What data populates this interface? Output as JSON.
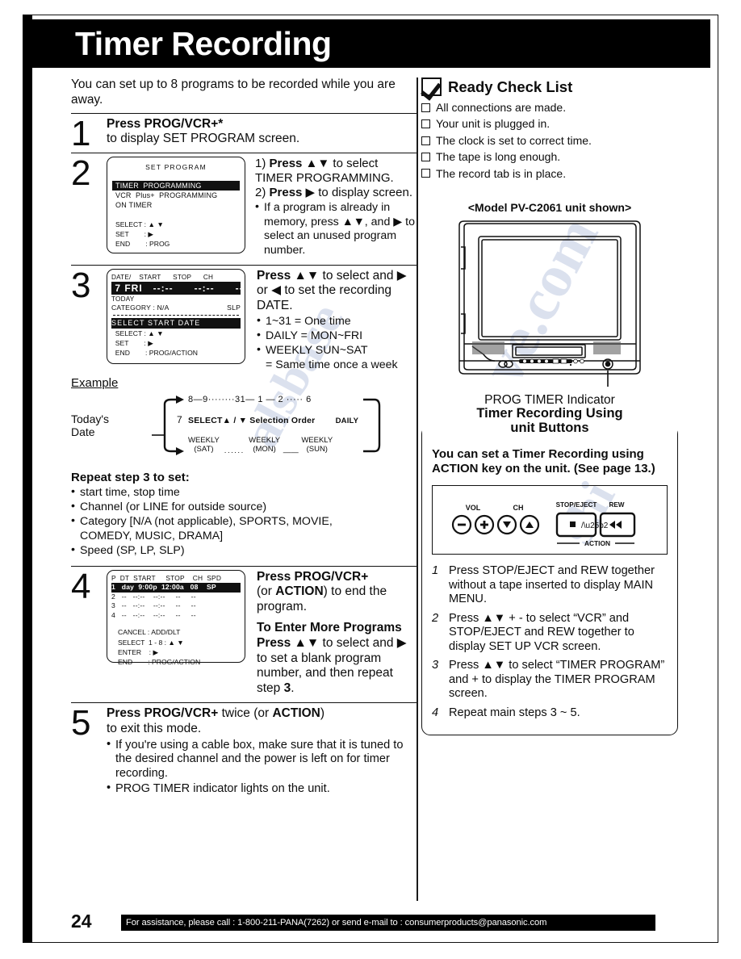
{
  "document": {
    "title": "Timer Recording",
    "page_number": "24",
    "footer_note": "For assistance, please call : 1-800-211-PANA(7262) or send e-mail to : consumerproducts@panasonic.com"
  },
  "intro": "You can set up to 8 programs to be recorded while you are away.",
  "steps": {
    "step1": {
      "number": "1",
      "bold": "Press PROG/VCR+*",
      "text": "to display SET PROGRAM screen."
    },
    "step2": {
      "number": "2",
      "osd": {
        "title": "SET PROGRAM",
        "items": [
          "TIMER  PROGRAMMING",
          "VCR  Plus+  PROGRAMMING",
          "ON TIMER"
        ],
        "keys": [
          "SELECT : ▲ ▼",
          "SET        : ▶",
          "END        : PROG"
        ]
      },
      "instr1_label": "1)",
      "instr1_bold": "Press ▲▼",
      "instr1_text": "to select TIMER PROGRAMMING.",
      "instr2_label": "2)",
      "instr2_bold": "Press ▶",
      "instr2_text": "to display screen.",
      "note": "If a program is already in memory, press ▲▼, and ▶ to select an unused program number."
    },
    "step3": {
      "number": "3",
      "osd": {
        "header": "DATE/    START      STOP      CH",
        "row_selected": " 7 FRI   --:--      --:--      --",
        "today": "TODAY",
        "category": "CATEGORY : N/A",
        "speed": "SLP",
        "banner": "SELECT START DATE",
        "keys": [
          "  SELECT : ▲ ▼",
          "  SET        : ▶",
          "  END        : PROG/ACTION"
        ]
      },
      "instr_bold": "Press ▲▼",
      "instr_text": "to select and ▶ or ◀ to set the recording DATE.",
      "bullets": [
        "1~31 = One time",
        "DAILY = MON~FRI",
        "WEEKLY SUN~SAT",
        "= Same time once a week"
      ]
    },
    "step4": {
      "number": "4",
      "osd": {
        "columns": "P  DT  START     STOP    CH  SPD",
        "rows": [
          "1   day  9:00p  12:00a   08    SP",
          "2   --   --:--    --:--     --     --",
          "3   --   --:--    --:--     --     --",
          "4   --   --:--    --:--     --     --"
        ],
        "keys": [
          "CANCEL : ADD/DLT",
          "SELECT  1 - 8 : ▲ ▼",
          "ENTER    : ▶",
          "END        : PROG/ACTION"
        ]
      },
      "instr_bold": "Press PROG/VCR+",
      "instr_bold2": "ACTION",
      "instr_text_pre": "(or ",
      "instr_text_post": ") to end the program.",
      "more_title": "To Enter More Programs",
      "more_bold": "Press ▲▼",
      "more_text": "to select and ▶ to set a blank program number, and then repeat step ",
      "more_step": "3",
      "more_period": "."
    },
    "step5": {
      "number": "5",
      "bold1": "Press PROG/VCR+",
      "mid": " twice (or ",
      "bold2": "ACTION",
      "end": ")",
      "text": "to exit this mode.",
      "bullets": [
        "If you're using a cable box, make sure that it is tuned to the desired channel and the power is left on for timer recording.",
        "PROG TIMER indicator lights on the unit."
      ]
    }
  },
  "example": {
    "label": "Example",
    "todays_line1": "Today's",
    "todays_line2": "Date",
    "today_value": "7",
    "top_sequence": "8—9········31— 1 — 2 ····· 6",
    "middle_left": "SELECT▲ / ▼ Selection Order",
    "middle_right": "DAILY",
    "bottom_items": [
      "WEEKLY (SAT)",
      "WEEKLY (MON)",
      "WEEKLY (SUN)"
    ],
    "bottom_1a": "WEEKLY",
    "bottom_1b": "(SAT)",
    "bottom_2a": "WEEKLY",
    "bottom_2b": "(MON)",
    "bottom_3a": "WEEKLY",
    "bottom_3b": "(SUN)",
    "dots_a": "······",
    "dash_b": "——"
  },
  "repeat": {
    "heading": "Repeat step 3 to set:",
    "items": [
      "start time, stop time",
      "Channel (or LINE for outside source)",
      "Category [N/A (not applicable), SPORTS, MOVIE,",
      "COMEDY, MUSIC, DRAMA]",
      "Speed (SP, LP, SLP)"
    ]
  },
  "ready_check": {
    "title": "Ready Check List",
    "items": [
      "All connections are made.",
      "Your unit is plugged in.",
      "The clock is set to correct time.",
      "The tape is long enough.",
      "The record tab is in place."
    ]
  },
  "unit": {
    "caption": "<Model PV-C2061 unit shown>",
    "indicator_label": "PROG TIMER Indicator"
  },
  "callout": {
    "title_line1": "Timer Recording Using",
    "title_line2": "unit Buttons",
    "lead": "You can set a Timer Recording using ACTION key on the unit. (See page 13.)",
    "panel": {
      "vol_label": "VOL",
      "ch_label": "CH",
      "minus": "−",
      "plus": "+",
      "ch_down": "▼",
      "ch_up": "▲",
      "stop_eject_label": "STOP/EJECT",
      "rew_label": "REW",
      "stop_eject_glyph": "■/▲",
      "rew_glyph": "◀◀",
      "action_label": "ACTION"
    },
    "steps": [
      {
        "n": "1",
        "text": "Press STOP/EJECT and REW together without a tape inserted to display MAIN MENU."
      },
      {
        "n": "2",
        "text": "Press ▲▼ + - to select “VCR” and STOP/EJECT and REW together to display SET UP VCR screen."
      },
      {
        "n": "3",
        "text": "Press ▲▼ to select “TIMER PROGRAM” and + to display the TIMER PROGRAM screen."
      },
      {
        "n": "4",
        "text": "Repeat main steps 3 ~ 5."
      }
    ]
  },
  "colors": {
    "ink": "#0d0d0d",
    "banner_bg": "#000000",
    "banner_fg": "#ffffff"
  }
}
